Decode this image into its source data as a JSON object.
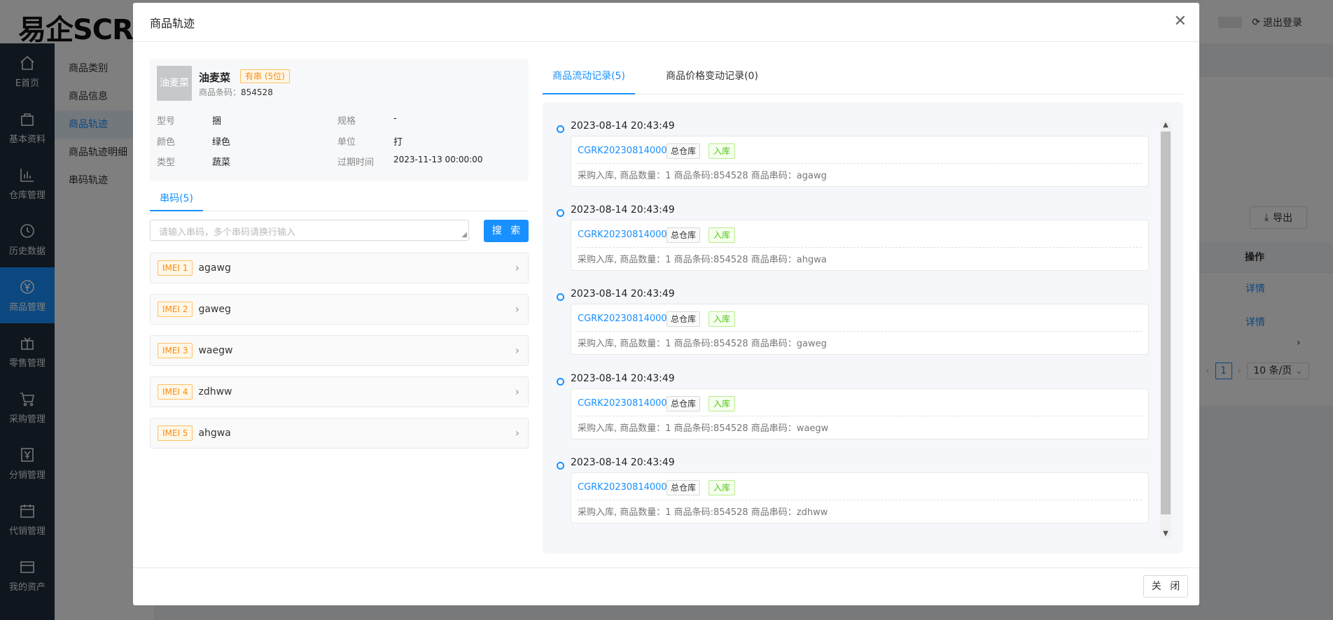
{
  "app": {
    "logo": "易企SCRM",
    "logout": "退出登录"
  },
  "sidebar": {
    "items": [
      {
        "label": "E首页",
        "icon": "home-icon"
      },
      {
        "label": "基本资料",
        "icon": "bag-icon"
      },
      {
        "label": "仓库管理",
        "icon": "chart-icon"
      },
      {
        "label": "历史数据",
        "icon": "clock-icon"
      },
      {
        "label": "商品管理",
        "icon": "yen-icon",
        "active": true
      },
      {
        "label": "零售管理",
        "icon": "gift-icon"
      },
      {
        "label": "采购管理",
        "icon": "cart-icon"
      },
      {
        "label": "分销管理",
        "icon": "yen-box-icon"
      },
      {
        "label": "代销管理",
        "icon": "calendar-icon"
      },
      {
        "label": "我的资产",
        "icon": "wallet-icon"
      }
    ]
  },
  "subnav": {
    "items": [
      "商品类别",
      "商品信息",
      "商品轨迹",
      "商品轨迹明细",
      "串码轨迹"
    ],
    "active_index": 2
  },
  "background_page": {
    "export_label": "导出",
    "op_header": "操作",
    "detail_link_1": "详情",
    "detail_link_2": "详情",
    "page_number": "1",
    "page_size": "10 条/页"
  },
  "modal": {
    "title": "商品轨迹",
    "close_label": "关 闭",
    "product": {
      "thumb_text": "油麦菜",
      "name": "油麦菜",
      "badge": "有串 (5位)",
      "code_label": "商品条码：",
      "code_value": "854528",
      "attrs": {
        "model_key": "型号",
        "model_val": "捆",
        "spec_key": "规格",
        "spec_val": "-",
        "color_key": "颜色",
        "color_val": "绿色",
        "unit_key": "单位",
        "unit_val": "打",
        "type_key": "类型",
        "type_val": "蔬菜",
        "expire_key": "过期时间",
        "expire_val": "2023-11-13 00:00:00"
      }
    },
    "serial_tab": "串码(5)",
    "search": {
      "placeholder": "请输入串码，多个串码请换行输入",
      "button": "搜 索"
    },
    "imei_list": [
      {
        "tag": "IMEI 1",
        "value": "agawg"
      },
      {
        "tag": "IMEI 2",
        "value": "gaweg"
      },
      {
        "tag": "IMEI 3",
        "value": "waegw"
      },
      {
        "tag": "IMEI 4",
        "value": "zdhww"
      },
      {
        "tag": "IMEI 5",
        "value": "ahgwa"
      }
    ],
    "right_tabs": {
      "flow": "商品流动记录(5)",
      "price": "商品价格变动记录(0)"
    },
    "timeline": [
      {
        "time": "2023-08-14 20:43:49",
        "order": "CGRK202308140001",
        "warehouse": "总仓库",
        "status": "入库",
        "desc": "采购入库, 商品数量：1 商品条码:854528 商品串码：agawg"
      },
      {
        "time": "2023-08-14 20:43:49",
        "order": "CGRK202308140001",
        "warehouse": "总仓库",
        "status": "入库",
        "desc": "采购入库, 商品数量：1 商品条码:854528 商品串码：ahgwa"
      },
      {
        "time": "2023-08-14 20:43:49",
        "order": "CGRK202308140001",
        "warehouse": "总仓库",
        "status": "入库",
        "desc": "采购入库, 商品数量：1 商品条码:854528 商品串码：gaweg"
      },
      {
        "time": "2023-08-14 20:43:49",
        "order": "CGRK202308140001",
        "warehouse": "总仓库",
        "status": "入库",
        "desc": "采购入库, 商品数量：1 商品条码:854528 商品串码：waegw"
      },
      {
        "time": "2023-08-14 20:43:49",
        "order": "CGRK202308140001",
        "warehouse": "总仓库",
        "status": "入库",
        "desc": "采购入库, 商品数量：1 商品条码:854528 商品串码：zdhww"
      }
    ]
  }
}
